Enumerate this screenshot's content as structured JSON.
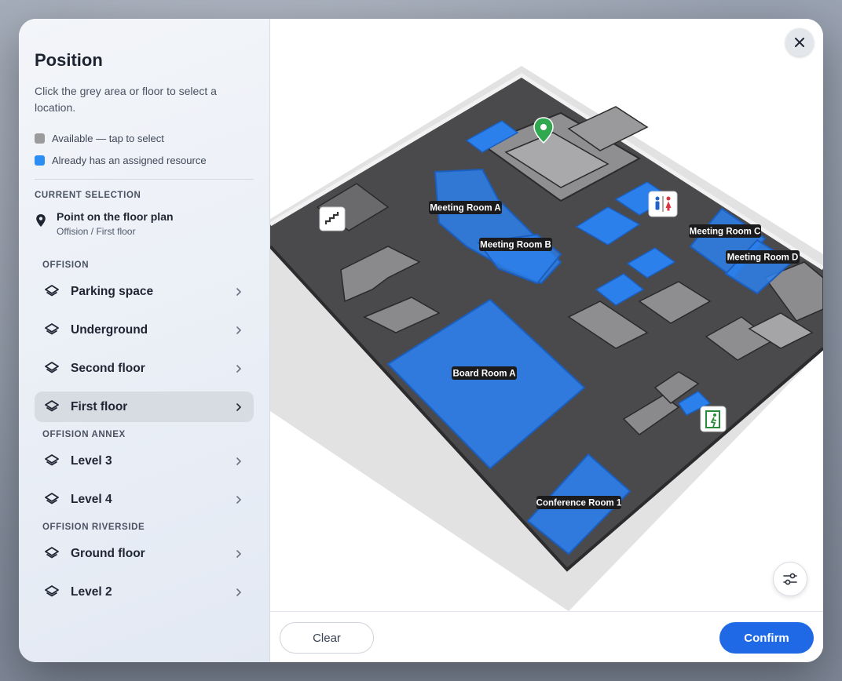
{
  "panel": {
    "title": "Position",
    "description": "Click the grey area or floor to select a location.",
    "legend": [
      {
        "label": "Available — tap to select",
        "color": "#9b9b9b"
      },
      {
        "label": "Already has an assigned resource",
        "color": "#2c8ef5"
      }
    ]
  },
  "selection": {
    "heading": "CURRENT SELECTION",
    "title": "Point on the floor plan",
    "subtitle": "Offision / First floor"
  },
  "groups": [
    {
      "name": "OFFISION",
      "floors": [
        "Parking space",
        "Underground",
        "Second floor",
        "First floor"
      ]
    },
    {
      "name": "OFFISION ANNEX",
      "floors": [
        "Level 3",
        "Level 4"
      ]
    },
    {
      "name": "OFFISION RIVERSIDE",
      "floors": [
        "Ground floor",
        "Level 2"
      ]
    }
  ],
  "selected_floor": "First floor",
  "map": {
    "rooms": {
      "meeting_a": "Meeting Room A",
      "meeting_b": "Meeting Room B",
      "meeting_c": "Meeting Room C",
      "meeting_d": "Meeting Room D",
      "board_a": "Board Room A",
      "conference_1": "Conference Room 1"
    },
    "colors": {
      "floor": "#4a4a4c",
      "assigned": "#2c80ec",
      "pin": "#2fa84f",
      "exit": "#2a8a3a"
    }
  },
  "footer": {
    "clear_label": "Clear",
    "confirm_label": "Confirm"
  },
  "accent": "#1f68e6"
}
